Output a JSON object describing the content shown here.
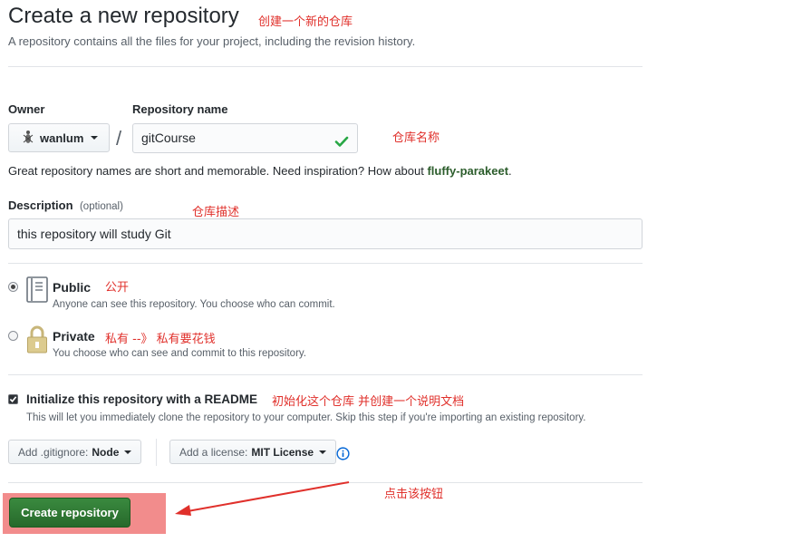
{
  "header": {
    "title": "Create a new repository",
    "subtitle": "A repository contains all the files for your project, including the revision history."
  },
  "owner": {
    "label": "Owner",
    "value": "wanlum"
  },
  "repo_name": {
    "label": "Repository name",
    "value": "gitCourse"
  },
  "separator": "/",
  "hint": {
    "prefix": "Great repository names are short and memorable. Need inspiration? How about ",
    "suggestion": "fluffy-parakeet",
    "suffix": "."
  },
  "description": {
    "label": "Description",
    "optional": "(optional)",
    "value": "this repository will study Git"
  },
  "visibility": {
    "public": {
      "title": "Public",
      "desc": "Anyone can see this repository. You choose who can commit.",
      "selected": true
    },
    "private": {
      "title": "Private",
      "desc": "You choose who can see and commit to this repository.",
      "selected": false
    }
  },
  "init": {
    "label": "Initialize this repository with a README",
    "desc": "This will let you immediately clone the repository to your computer. Skip this step if you're importing an existing repository.",
    "checked": true
  },
  "gitignore": {
    "prefix": "Add .gitignore:",
    "value": "Node"
  },
  "license": {
    "prefix": "Add a license:",
    "value": "MIT License"
  },
  "create_button": "Create repository",
  "annotations": {
    "title": "创建一个新的仓库",
    "repo_name": "仓库名称",
    "description": "仓库描述",
    "public": "公开",
    "private": "私有 --》 私有要花钱",
    "init": "初始化这个仓库 并创建一个说明文档",
    "click": "点击该按钮"
  },
  "colors": {
    "annotation": "#e0302b",
    "create_button": "#2c7a31",
    "highlight": "#f28c8c",
    "check": "#28a745",
    "info": "#0366d6"
  }
}
